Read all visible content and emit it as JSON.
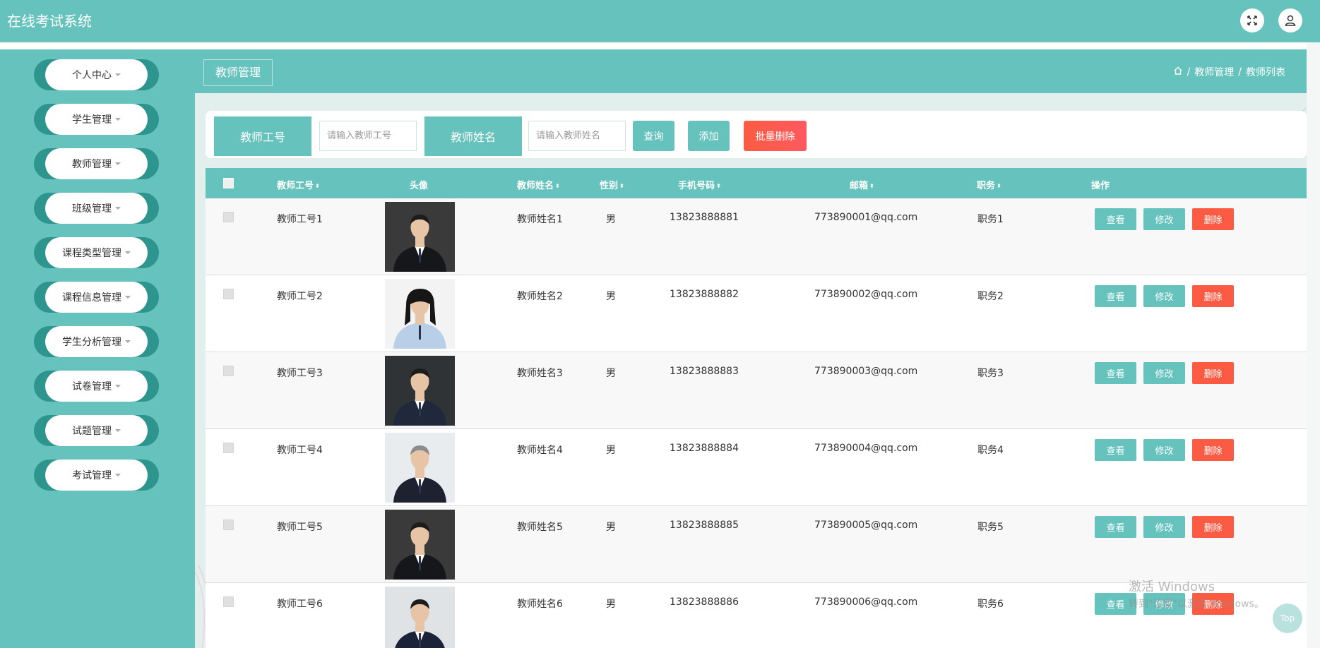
{
  "app": {
    "title": "在线考试系统"
  },
  "header_icons": [
    {
      "name": "fullscreen-icon"
    },
    {
      "name": "user-icon"
    }
  ],
  "sidebar": {
    "items": [
      {
        "label": "个人中心"
      },
      {
        "label": "学生管理"
      },
      {
        "label": "教师管理"
      },
      {
        "label": "班级管理"
      },
      {
        "label": "课程类型管理"
      },
      {
        "label": "课程信息管理"
      },
      {
        "label": "学生分析管理"
      },
      {
        "label": "试卷管理"
      },
      {
        "label": "试题管理"
      },
      {
        "label": "考试管理"
      }
    ]
  },
  "page": {
    "tab": "教师管理",
    "breadcrumb": {
      "section": "教师管理",
      "sep": "/",
      "current": "教师列表"
    }
  },
  "search": {
    "teacher_id_label": "教师工号",
    "teacher_id_placeholder": "请输入教师工号",
    "teacher_name_label": "教师姓名",
    "teacher_name_placeholder": "请输入教师姓名",
    "query_label": "查询",
    "add_label": "添加",
    "batch_delete_label": "批量删除"
  },
  "table": {
    "columns": [
      "教师工号",
      "头像",
      "教师姓名",
      "性别",
      "手机号码",
      "邮箱",
      "职务",
      "操作"
    ],
    "rows": [
      {
        "id": "教师工号1",
        "name": "教师姓名1",
        "gender": "男",
        "phone": "13823888881",
        "email": "773890001@qq.com",
        "title": "职务1",
        "avatar": "man-black-suit"
      },
      {
        "id": "教师工号2",
        "name": "教师姓名2",
        "gender": "男",
        "phone": "13823888882",
        "email": "773890002@qq.com",
        "title": "职务2",
        "avatar": "woman-light-blue"
      },
      {
        "id": "教师工号3",
        "name": "教师姓名3",
        "gender": "男",
        "phone": "13823888883",
        "email": "773890003@qq.com",
        "title": "职务3",
        "avatar": "man-seated-navy"
      },
      {
        "id": "教师工号4",
        "name": "教师姓名4",
        "gender": "男",
        "phone": "13823888884",
        "email": "773890004@qq.com",
        "title": "职务4",
        "avatar": "man-gray-hair"
      },
      {
        "id": "教师工号5",
        "name": "教师姓名5",
        "gender": "男",
        "phone": "13823888885",
        "email": "773890005@qq.com",
        "title": "职务5",
        "avatar": "man-black-suit"
      },
      {
        "id": "教师工号6",
        "name": "教师姓名6",
        "gender": "男",
        "phone": "13823888886",
        "email": "773890006@qq.com",
        "title": "职务6",
        "avatar": "man-navy-suit"
      }
    ],
    "actions": {
      "view": "查看",
      "edit": "修改",
      "delete": "删除"
    }
  },
  "watermark": {
    "line1": "激活 Windows",
    "line2": "转到\"设置\"以激活 Windows。"
  },
  "top_button": "Top",
  "colors": {
    "primary": "#66c2bd",
    "danger": "#fb5b42",
    "sidebar_ring": "#2e948e"
  }
}
